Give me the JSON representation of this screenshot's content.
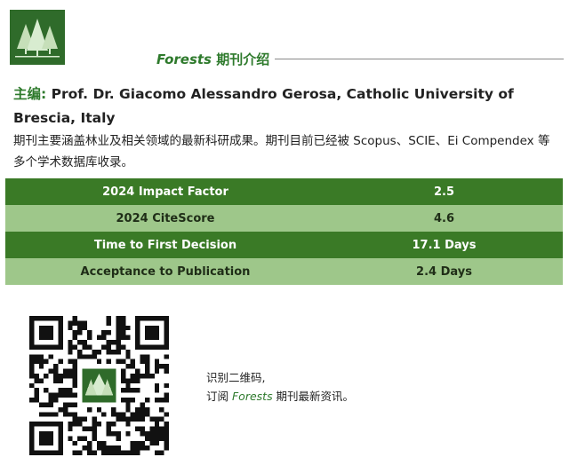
{
  "header": {
    "journal_name": "Forests",
    "title_suffix": " 期刊介绍"
  },
  "editor": {
    "label": "主编:",
    "text": "Prof. Dr. Giacomo Alessandro Gerosa, Catholic University of Brescia, Italy"
  },
  "description": "期刊主要涵盖林业及相关领域的最新科研成果。期刊目前已经被 Scopus、SCIE、Ei Compendex 等多个学术数据库收录。",
  "metrics": [
    {
      "name": "2024 Impact Factor",
      "value": "2.5"
    },
    {
      "name": "2024 CiteScore",
      "value": "4.6"
    },
    {
      "name": "Time to First Decision",
      "value": "17.1 Days"
    },
    {
      "name": "Acceptance to Publication",
      "value": "2.4 Days"
    }
  ],
  "qr": {
    "line1": "识别二维码,",
    "line2_prefix": "订阅 ",
    "line2_journal": "Forests",
    "line2_suffix": " 期刊最新资讯。"
  },
  "colors": {
    "brand_green": "#2e7a2c",
    "row_dark": "#3a7a26",
    "row_light": "#9ec78a",
    "logo_bg": "#2f6b2a"
  },
  "icons": {
    "logo": "forest-trees-logo-icon",
    "qr": "qr-code-icon"
  }
}
